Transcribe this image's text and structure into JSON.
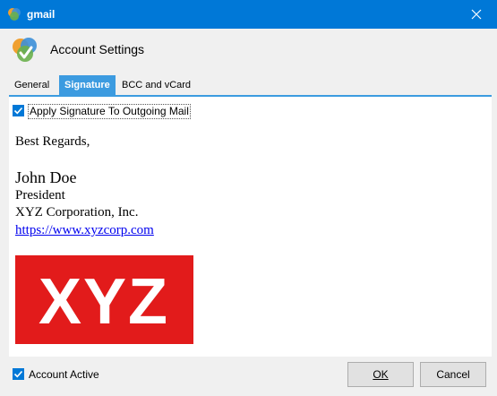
{
  "window": {
    "title": "gmail",
    "app_icon": "multicolor-app-icon",
    "close_icon": "close-icon"
  },
  "header": {
    "title": "Account Settings",
    "icon": "account-settings-icon"
  },
  "tabs": [
    {
      "label": "General",
      "selected": false
    },
    {
      "label": "Signature",
      "selected": true
    },
    {
      "label": "BCC and vCard",
      "selected": false
    }
  ],
  "signature": {
    "apply_label": "Apply Signature To Outgoing Mail",
    "apply_checked": true,
    "lines": {
      "regards": "Best Regards,",
      "name": "John Doe",
      "role": "President",
      "company": "XYZ Corporation, Inc.",
      "link": "https://www.xyzcorp.com"
    },
    "logo_text": "XYZ",
    "logo_color": "#e21b1b"
  },
  "footer": {
    "account_active_label": "Account Active",
    "account_active_checked": true,
    "ok_label": "OK",
    "cancel_label": "Cancel"
  },
  "colors": {
    "accent": "#0078d7",
    "tab_selected": "#3c9be0"
  }
}
